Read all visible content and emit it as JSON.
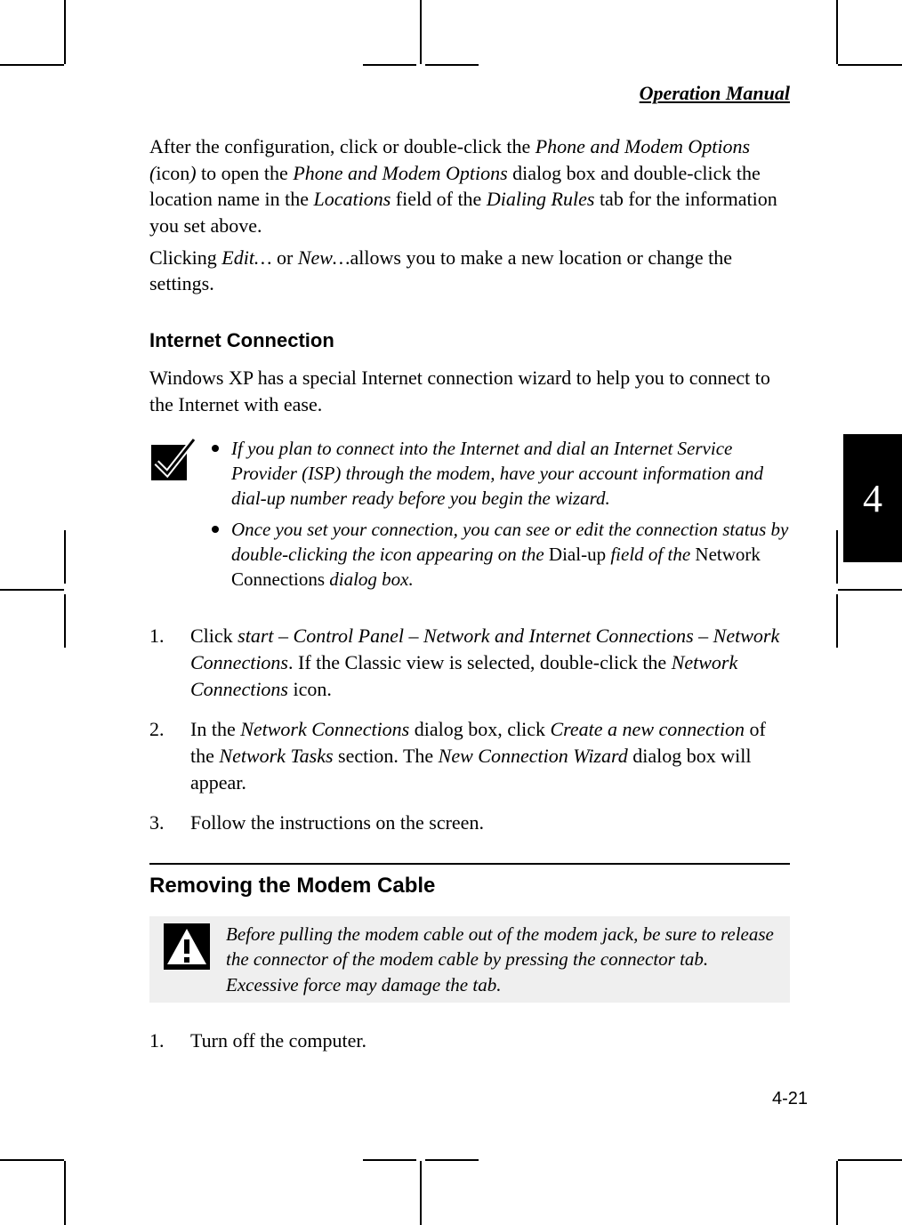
{
  "running_head": "Operation Manual",
  "chapter_tab": "4",
  "page_number": "4-21",
  "intro": {
    "p1_a": "After the configuration, click or double-click the",
    "p1_b": "Phone and Modem Options (",
    "p1_c": "icon",
    "p1_d": ")",
    "p1_e": "to open the",
    "p1_f": "Phone and Modem Options",
    "p1_g": "dialog box and double-click the location name in the",
    "p1_h": "Locations",
    "p1_i": "field of the",
    "p1_j": "Dialing Rules",
    "p1_k": "tab for the information you set above.",
    "p2_a": "Clicking",
    "p2_b": "Edit…",
    "p2_c": "or",
    "p2_d": "New…",
    "p2_e": "allows you to make a new location or change the settings."
  },
  "headings": {
    "internet_connection": "Internet Connection",
    "removing_modem": "Removing the Modem Cable"
  },
  "internet_intro": "Windows XP has a special Internet connection wizard to help you to connect to the Internet with ease.",
  "note": {
    "bullet1": "If you plan to connect into the Internet and dial an Internet Service Provider (ISP) through the modem, have your account information and dial-up number ready before you begin the wizard.",
    "bullet2_a": "Once you set your connection, you can see or edit the connection status by double-clicking the icon appearing on the",
    "bullet2_b": "Dial-up",
    "bullet2_c": "field of the",
    "bullet2_d": "Network Connections",
    "bullet2_e": "dialog box."
  },
  "steps": [
    {
      "num": "1.",
      "a": "Click",
      "b": "start – Control Panel – Network and Internet Connections – Network Connections",
      "c": ". If the Classic view is selected, double-click the",
      "d": "Network Connections",
      "e": "icon."
    },
    {
      "num": "2.",
      "a": "In the",
      "b": "Network Connections",
      "c": "dialog box, click",
      "d": "Create a new connection",
      "e": "of the",
      "f": "Network Tasks",
      "g": "section. The",
      "h": "New Connection Wizard",
      "i": "dialog box will appear."
    },
    {
      "num": "3.",
      "a": "Follow the instructions on the screen."
    }
  ],
  "warning_text": "Before pulling the modem cable out of the modem jack, be sure to release the connector of the modem cable by pressing the connector tab. Excessive force may damage the tab.",
  "steps2": [
    {
      "num": "1.",
      "a": "Turn off the computer."
    }
  ]
}
